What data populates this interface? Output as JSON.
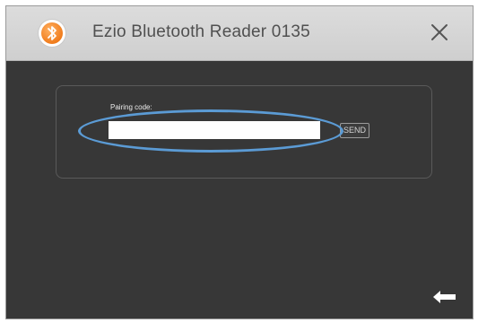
{
  "window": {
    "title": "Ezio Bluetooth Reader 0135"
  },
  "form": {
    "pairing_label": "Pairing code:",
    "pairing_value": "",
    "send_label": "SEND"
  },
  "colors": {
    "accent_orange": "#f07c1c",
    "highlight_blue": "#5b9bd5",
    "body_bg": "#373737",
    "titlebar_bg": "#d6d6d6"
  },
  "icons": {
    "app": "bluetooth-icon",
    "close": "close-icon",
    "back": "back-arrow-icon"
  }
}
